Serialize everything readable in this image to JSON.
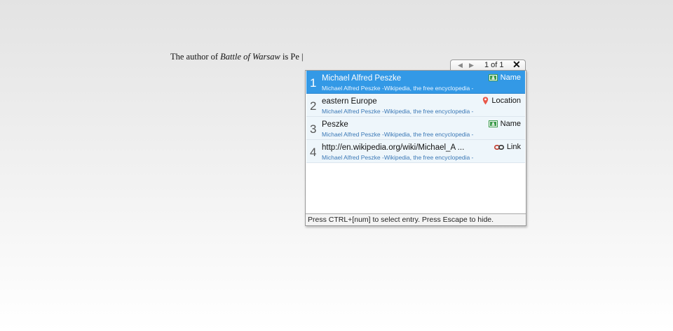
{
  "editor": {
    "text_before": "The author of ",
    "italic_title": "Battle of Warsaw",
    "text_after": " is Pe |"
  },
  "nav": {
    "prev_icon": "triangle-left-icon",
    "next_icon": "triangle-right-icon",
    "pager": "1 of 1",
    "close_icon": "close-icon"
  },
  "entries": [
    {
      "num": "1",
      "title": "Michael Alfred Peszke",
      "sub": "Michael Alfred Peszke -Wikipedia, the free encyclopedia -",
      "type": "Name",
      "icon": "person-card-icon"
    },
    {
      "num": "2",
      "title": "eastern Europe",
      "sub": "Michael Alfred Peszke -Wikipedia, the free encyclopedia -",
      "type": "Location",
      "icon": "map-pin-icon"
    },
    {
      "num": "3",
      "title": "Peszke",
      "sub": "Michael Alfred Peszke -Wikipedia, the free encyclopedia -",
      "type": "Name",
      "icon": "person-card-icon"
    },
    {
      "num": "4",
      "title": "http://en.wikipedia.org/wiki/Michael_A ...",
      "sub": "Michael Alfred Peszke -Wikipedia, the free encyclopedia -",
      "type": "Link",
      "icon": "chain-link-icon"
    }
  ],
  "status": "Press CTRL+[num] to select entry. Press Escape to hide.",
  "colors": {
    "selected": "#3399e6",
    "row": "#eef6fb",
    "pin": "#e8584a",
    "card": "#3a9a4a"
  }
}
